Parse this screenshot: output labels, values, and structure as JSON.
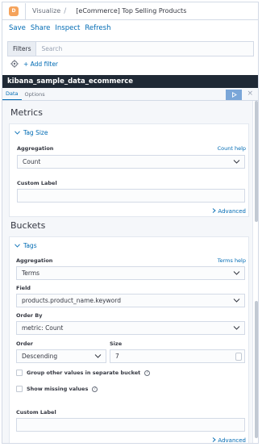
{
  "breadcrumb": {
    "logo_letter": "D",
    "parent": "Visualize",
    "separator": "/",
    "current": "[eCommerce] Top Selling Products"
  },
  "actions": [
    "Save",
    "Share",
    "Inspect",
    "Refresh"
  ],
  "filters": {
    "label": "Filters",
    "placeholder": "Search",
    "add_filter": "+ Add filter"
  },
  "index_pattern": "kibana_sample_data_ecommerce",
  "editor_tabs": [
    {
      "label": "Data",
      "active": true
    },
    {
      "label": "Options",
      "active": false
    }
  ],
  "metrics": {
    "title": "Metrics",
    "agg_name": "Tag Size",
    "aggregation_label": "Aggregation",
    "aggregation_help": "Count help",
    "aggregation_value": "Count",
    "custom_label": "Custom Label",
    "custom_label_value": "",
    "advanced": "Advanced"
  },
  "buckets": {
    "title": "Buckets",
    "agg_name": "Tags",
    "aggregation_label": "Aggregation",
    "aggregation_help": "Terms help",
    "aggregation_value": "Terms",
    "field_label": "Field",
    "field_value": "products.product_name.keyword",
    "order_by_label": "Order By",
    "order_by_value": "metric: Count",
    "order_label": "Order",
    "order_value": "Descending",
    "size_label": "Size",
    "size_value": "7",
    "group_other": "Group other values in separate bucket",
    "show_missing": "Show missing values",
    "custom_label": "Custom Label",
    "custom_label_value": "",
    "advanced": "Advanced"
  },
  "colors": {
    "accent": "#006bb4",
    "index_bar": "#1f2935",
    "play_button": "#7aa6d8",
    "logo": "#f5a35c"
  },
  "icons": {
    "play": "play-icon",
    "close": "close-icon",
    "gear": "gear-icon",
    "chevron": "chevron-down-icon",
    "collapse": "chevron-down-icon",
    "advanced": "chevron-right-icon",
    "info": "info-icon"
  }
}
